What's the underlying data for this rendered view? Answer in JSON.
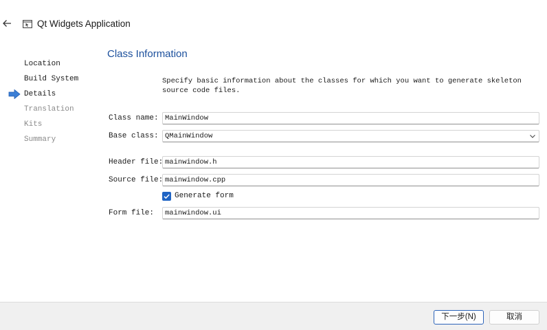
{
  "window": {
    "title": "Qt Widgets Application",
    "icons": {
      "back": "back-arrow-icon",
      "app": "window-icon"
    }
  },
  "steps": [
    {
      "label": "Location",
      "state": "done"
    },
    {
      "label": "Build System",
      "state": "done"
    },
    {
      "label": "Details",
      "state": "current"
    },
    {
      "label": "Translation",
      "state": "pending"
    },
    {
      "label": "Kits",
      "state": "pending"
    },
    {
      "label": "Summary",
      "state": "pending"
    }
  ],
  "page": {
    "title": "Class Information",
    "description": "Specify basic information about the classes for which you want to generate skeleton source code files."
  },
  "form": {
    "class_name": {
      "label": "Class name:",
      "value": "MainWindow"
    },
    "base_class": {
      "label": "Base class:",
      "value": "QMainWindow"
    },
    "header_file": {
      "label": "Header file:",
      "value": "mainwindow.h"
    },
    "source_file": {
      "label": "Source file:",
      "value": "mainwindow.cpp"
    },
    "generate_form": {
      "label": "Generate form",
      "checked": true
    },
    "form_file": {
      "label": "Form file:",
      "value": "mainwindow.ui"
    }
  },
  "buttons": {
    "next": "下一步(N)",
    "cancel": "取消"
  },
  "colors": {
    "accent": "#1f64c4",
    "heading": "#1b4f9c",
    "bottom_bar": "#f0f0f0"
  }
}
